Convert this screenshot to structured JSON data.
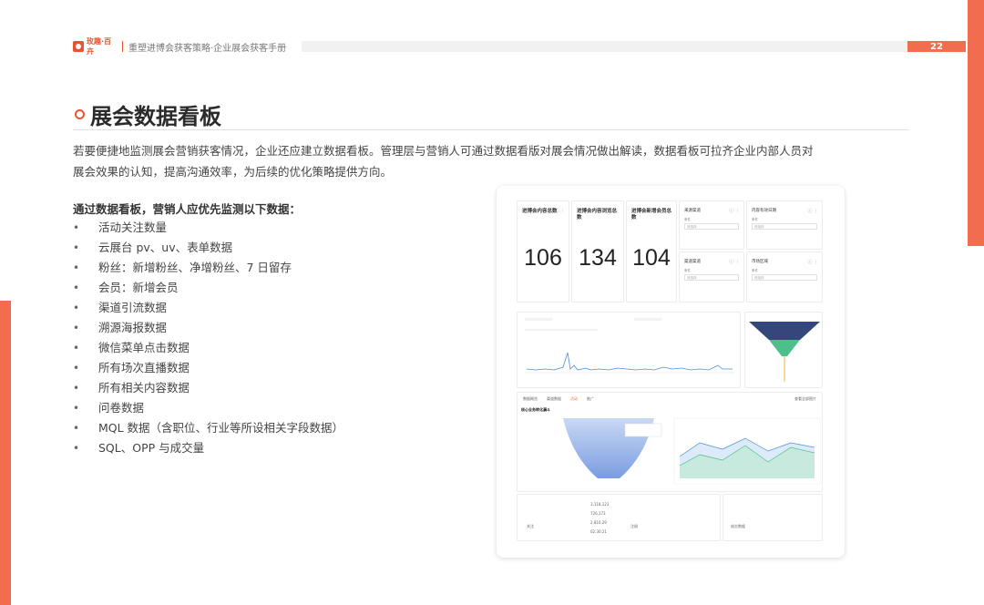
{
  "header": {
    "logo_text": "玫趣·百卉",
    "title": "重塑进博会获客策略·企业展会获客手册",
    "page_number": "22"
  },
  "section": {
    "title": "展会数据看板"
  },
  "intro": {
    "line1": "若要便捷地监测展会营销获客情况，企业还应建立数据看板。管理层与营销人可通过数据看版对展会情况做出解读，数据看板可拉齐企业内部人员对",
    "line2": "展会效果的认知，提高沟通效率，为后续的优化策略提供方向。"
  },
  "list": {
    "heading": "通过数据看板，营销人应优先监测以下数据：",
    "bullet_glyph": "•",
    "items": [
      "活动关注数量",
      "云展台 pv、uv、表单数据",
      "粉丝：新增粉丝、净增粉丝、7 日留存",
      "会员：新增会员",
      "渠道引流数据",
      "溯源海报数据",
      "微信菜单点击数据",
      "所有场次直播数据",
      "所有相关内容数据",
      "问卷数据",
      "MQL 数据（含职位、行业等所设相关字段数据）",
      "SQL、OPP 与成交量"
    ]
  },
  "dashboard": {
    "kpis": [
      {
        "title": "进博会内容总数",
        "value": "106"
      },
      {
        "title": "进博会内容浏览总数",
        "value": "134"
      },
      {
        "title": "进博会新增会员总数",
        "value": "104"
      }
    ],
    "icons": "ⓘ ⋮",
    "filters": [
      "来源渠道",
      "内容有效日期",
      "渠道渠道",
      "市场区域"
    ],
    "filter_sub": "条件",
    "filter_placeholder": "请选择",
    "tabs": [
      "数据概览",
      "渠道数据",
      "活动",
      "推广"
    ],
    "tab_right": "查看全部图片",
    "funnel_title": "核心业务转化漏斗",
    "bottom_labels": [
      "关注",
      "注册",
      "成交数据"
    ],
    "bottom_values": [
      "3,118,123",
      "726,173",
      "2,810,29",
      "02:30:21"
    ],
    "colors": {
      "line": "#4e8fd6",
      "funnel_top": "#33477a",
      "funnel_bottom": "#4cbf8a",
      "accent": "#f26c4f"
    }
  }
}
